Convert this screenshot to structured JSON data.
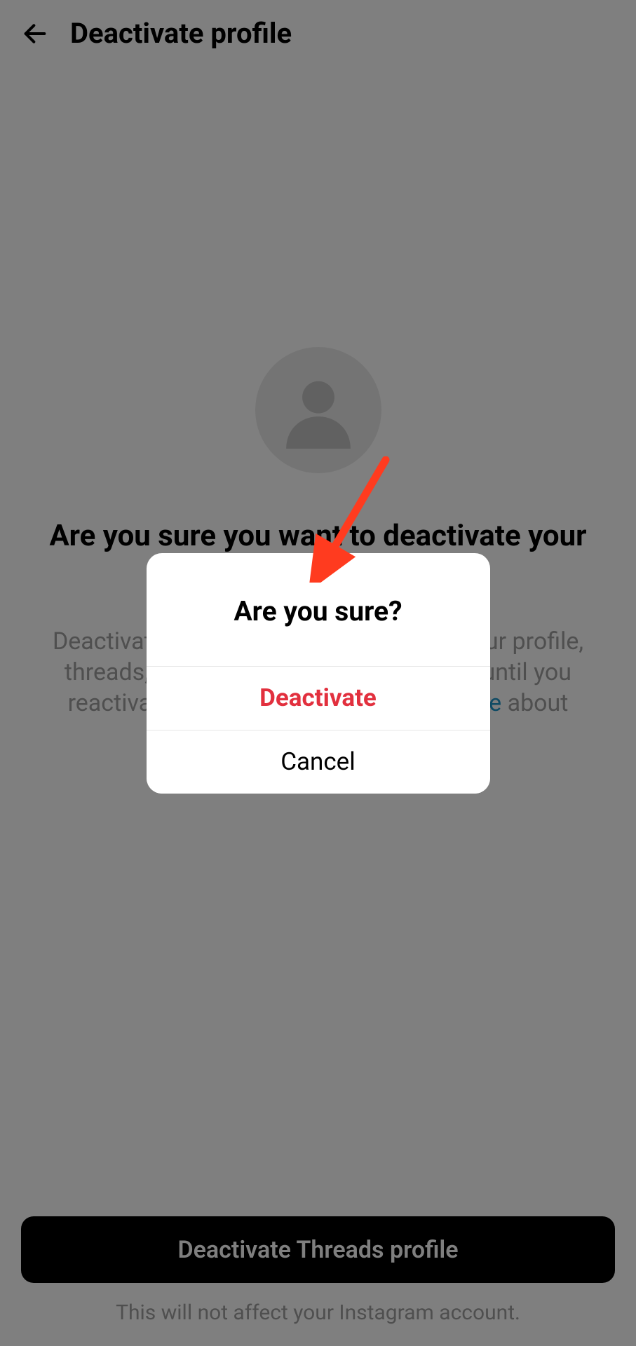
{
  "header": {
    "title": "Deactivate profile"
  },
  "main": {
    "question_line": "Are you sure you want to deactivate your profile?",
    "desc_part1": "Deactivating your profile is temporary. Your profile, threads, replies and likes will be hidden until you reactivate by logging back in. ",
    "learn_more": "Learn more",
    "desc_part2": " about how to delete your data."
  },
  "footer": {
    "button_label": "Deactivate Threads profile",
    "footnote": "This will not affect your Instagram account."
  },
  "dialog": {
    "title": "Are you sure?",
    "deactivate_label": "Deactivate",
    "cancel_label": "Cancel"
  },
  "colors": {
    "destructive": "#e2303e",
    "annotation": "#ff3b1f"
  }
}
